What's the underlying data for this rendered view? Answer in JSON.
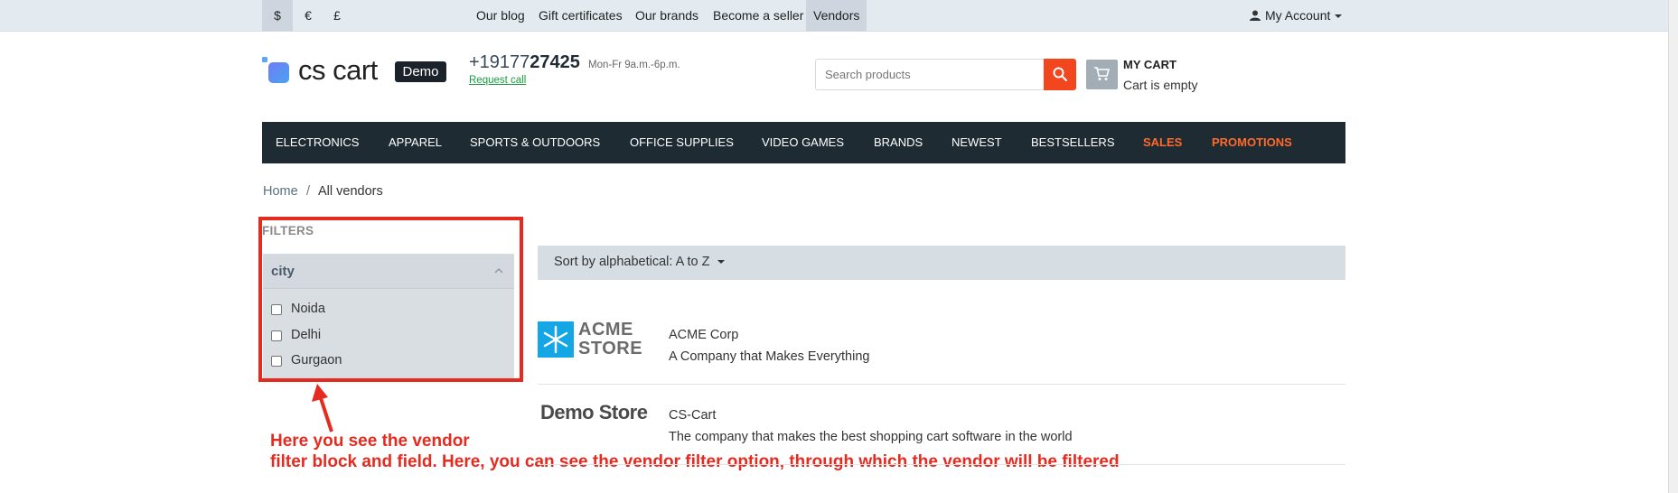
{
  "topbar": {
    "currencies": [
      "$",
      "€",
      "£"
    ],
    "links": [
      "Our blog",
      "Gift certificates",
      "Our brands",
      "Become a seller",
      "Vendors"
    ],
    "account_label": "My Account"
  },
  "header": {
    "logo_text": "cs cart",
    "demo_badge": "Demo",
    "phone_prefix": "+19177",
    "phone_bold": "27425",
    "phone_hours": "Mon-Fr 9a.m.-6p.m.",
    "request_call": "Request call",
    "search_placeholder": "Search products",
    "cart_title": "MY CART",
    "cart_status": "Cart is empty"
  },
  "menu": [
    "ELECTRONICS",
    "APPAREL",
    "SPORTS & OUTDOORS",
    "OFFICE SUPPLIES",
    "VIDEO GAMES",
    "BRANDS",
    "NEWEST",
    "BESTSELLERS",
    "SALES",
    "PROMOTIONS"
  ],
  "breadcrumbs": {
    "home": "Home",
    "separator": "/",
    "current": "All vendors"
  },
  "filters": {
    "title": "FILTERS",
    "group_label": "city",
    "options": [
      "Noida",
      "Delhi",
      "Gurgaon"
    ]
  },
  "sort": {
    "label": "Sort by alphabetical: A to Z"
  },
  "vendors": [
    {
      "logo_line1": "ACME",
      "logo_line2": "STORE",
      "name": "ACME Corp",
      "description": "A Company that Makes Everything"
    },
    {
      "logo_text": "Demo Store",
      "name": "CS-Cart",
      "description": "The company that makes the best shopping cart software in the world"
    }
  ],
  "annotation": {
    "line1": "Here you see the vendor",
    "line2": "filter block and field. Here, you can see the vendor filter option, through which the vendor will be filtered"
  },
  "colors": {
    "accent": "#f1461e",
    "menu_bg": "#1f2b33",
    "annotation": "#e52b20",
    "hot_menu": "#ff6a2b"
  }
}
